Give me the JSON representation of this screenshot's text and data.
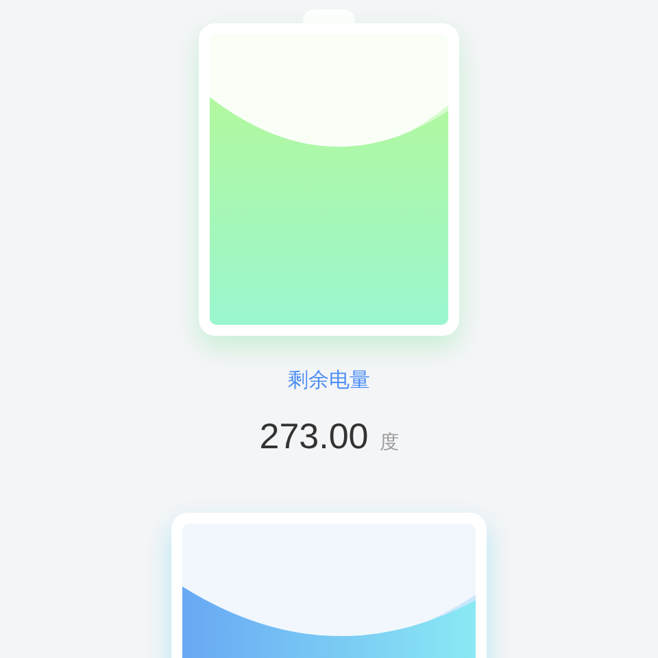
{
  "batteries": [
    {
      "kind": "green",
      "label": "剩余电量",
      "value": "273.00",
      "unit": "度"
    },
    {
      "kind": "blue"
    }
  ]
}
